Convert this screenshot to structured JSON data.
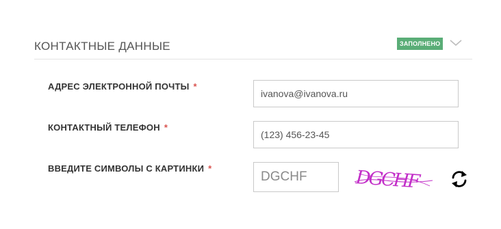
{
  "section": {
    "title": "КОНТАКТНЫЕ ДАННЫЕ",
    "status": "ЗАПОЛНЕНО",
    "accent": "#5aad77",
    "required_color": "#d9534f"
  },
  "fields": {
    "email": {
      "label": "АДРЕС ЭЛЕКТРОННОЙ ПОЧТЫ",
      "value": "ivanova@ivanova.ru",
      "required": "*"
    },
    "phone": {
      "label": "КОНТАКТНЫЙ ТЕЛЕФОН",
      "value": "(123) 456-23-45",
      "required": "*"
    },
    "captcha": {
      "label": "ВВЕДИТЕ СИМВОЛЫ С КАРТИНКИ",
      "value": "DGCHF",
      "required": "*",
      "image_text": "DGCHF",
      "refresh_icon": "refresh-icon"
    }
  },
  "icons": {
    "chevron": "chevron-down-icon"
  }
}
